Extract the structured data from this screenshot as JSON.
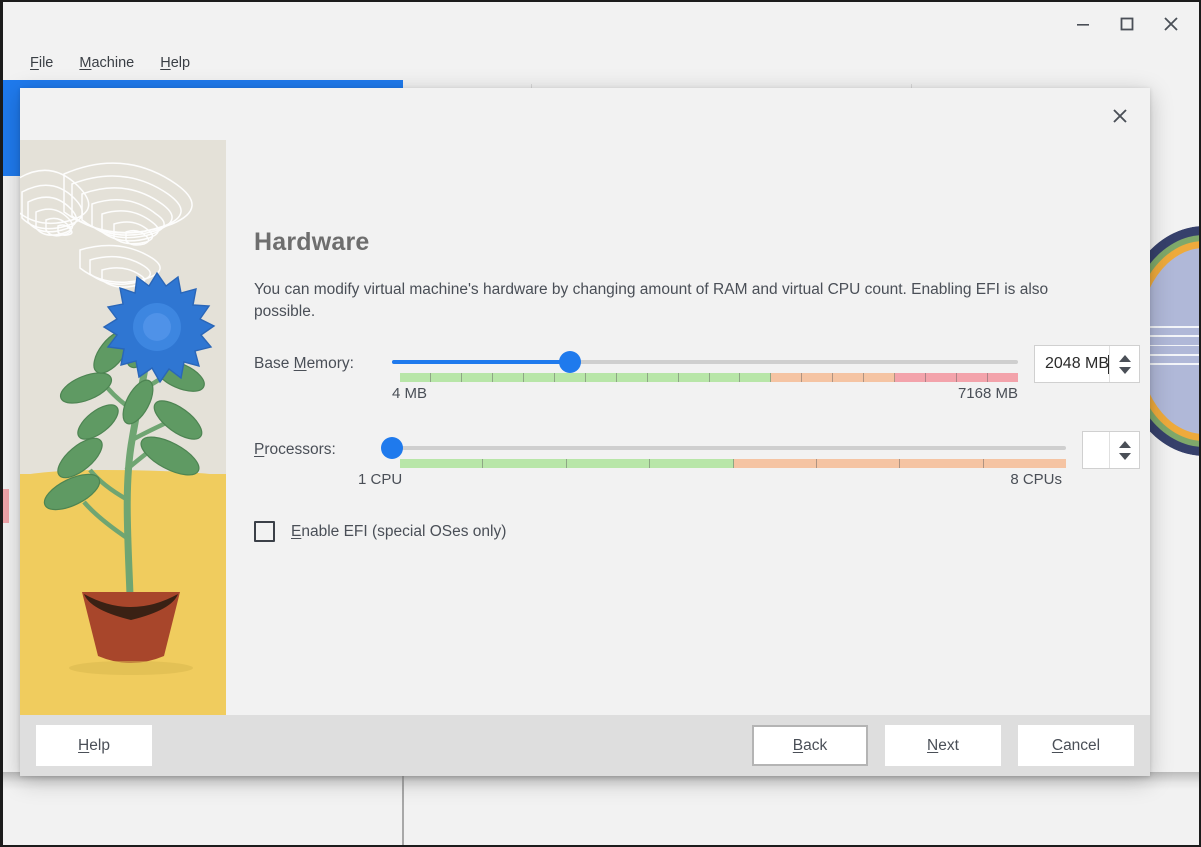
{
  "window": {
    "controls": [
      {
        "name": "minimize",
        "glyph": "minimize-icon"
      },
      {
        "name": "maximize",
        "glyph": "maximize-icon"
      },
      {
        "name": "close",
        "glyph": "close-icon"
      }
    ],
    "menu": [
      {
        "label": "File",
        "mnemonic": "F"
      },
      {
        "label": "Machine",
        "mnemonic": "M"
      },
      {
        "label": "Help",
        "mnemonic": "H"
      }
    ]
  },
  "dialog": {
    "close_icon": "close-icon",
    "title": "Hardware",
    "description": "You can modify virtual machine's hardware by changing amount of RAM and virtual CPU count. Enabling EFI is also possible.",
    "illustration": {
      "name": "potted-flower-illustration",
      "sky_color": "#e4e1d8",
      "ground_color": "#f0cc5e",
      "flower_color": "#2f76d2",
      "leaf_color": "#5f9a63",
      "pot_color": "#a8462b"
    },
    "base_memory": {
      "label": "Base Memory:",
      "mnemonic": "M",
      "value_text": "2048 MB",
      "min_text": "4 MB",
      "max_text": "7168 MB",
      "handle_percent": 28.5,
      "fill_color": "#1f7aed",
      "track_color": "#cfcfcf",
      "tick_segments": [
        {
          "color": "#b8e6a8",
          "flex": 1
        },
        {
          "color": "#b8e6a8",
          "flex": 1
        },
        {
          "color": "#b8e6a8",
          "flex": 1
        },
        {
          "color": "#b8e6a8",
          "flex": 1
        },
        {
          "color": "#b8e6a8",
          "flex": 1
        },
        {
          "color": "#b8e6a8",
          "flex": 1
        },
        {
          "color": "#b8e6a8",
          "flex": 1
        },
        {
          "color": "#b8e6a8",
          "flex": 1
        },
        {
          "color": "#b8e6a8",
          "flex": 1
        },
        {
          "color": "#b8e6a8",
          "flex": 1
        },
        {
          "color": "#b8e6a8",
          "flex": 1
        },
        {
          "color": "#b8e6a8",
          "flex": 1
        },
        {
          "color": "#f5c4a3",
          "flex": 1
        },
        {
          "color": "#f5c4a3",
          "flex": 1
        },
        {
          "color": "#f5c4a3",
          "flex": 1
        },
        {
          "color": "#f5c4a3",
          "flex": 1
        },
        {
          "color": "#f3a3ab",
          "flex": 1
        },
        {
          "color": "#f3a3ab",
          "flex": 1
        },
        {
          "color": "#f3a3ab",
          "flex": 1
        },
        {
          "color": "#f3a3ab",
          "flex": 1
        }
      ]
    },
    "processors": {
      "label": "Processors:",
      "mnemonic": "P",
      "value_text": "",
      "min_text": "1 CPU",
      "max_text": "8 CPUs",
      "handle_percent": 0,
      "tick_segments": [
        {
          "color": "#b8e6a8",
          "flex": 1
        },
        {
          "color": "#b8e6a8",
          "flex": 1
        },
        {
          "color": "#b8e6a8",
          "flex": 1
        },
        {
          "color": "#b8e6a8",
          "flex": 1
        },
        {
          "color": "#f5c4a3",
          "flex": 1
        },
        {
          "color": "#f5c4a3",
          "flex": 1
        },
        {
          "color": "#f5c4a3",
          "flex": 1
        },
        {
          "color": "#f5c4a3",
          "flex": 1
        }
      ]
    },
    "efi": {
      "label": "Enable EFI (special OSes only)",
      "mnemonic": "E",
      "checked": false
    },
    "buttons": {
      "help": {
        "label": "Help",
        "mnemonic": "H",
        "focused": false
      },
      "back": {
        "label": "Back",
        "mnemonic": "B",
        "focused": true
      },
      "next": {
        "label": "Next",
        "mnemonic": "N",
        "focused": false
      },
      "cancel": {
        "label": "Cancel",
        "mnemonic": "C",
        "focused": false
      }
    }
  },
  "background": {
    "selected_row_color": "#1f7aed",
    "toolbar_icons": [
      "settings-wrench-icon",
      "discard-orange-icon",
      "start-blue-icon",
      "star-grey-icon",
      "new-plus-green-icon"
    ],
    "decoration": "vm-disc-graphic"
  }
}
